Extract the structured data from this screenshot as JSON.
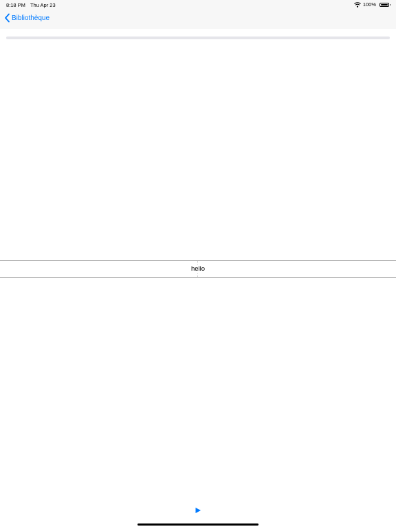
{
  "status_bar": {
    "time": "8:18 PM",
    "date": "Thu Apr 23",
    "battery_percent": "100%",
    "battery_level": 1.0
  },
  "nav": {
    "back_label": "Bibliothèque"
  },
  "playback": {
    "progress": 0.0
  },
  "reader": {
    "word": "hello"
  },
  "icons": {
    "back": "chevron-left-icon",
    "play": "play-icon",
    "wifi": "wifi-icon",
    "battery": "battery-icon"
  },
  "colors": {
    "accent": "#007aff"
  }
}
